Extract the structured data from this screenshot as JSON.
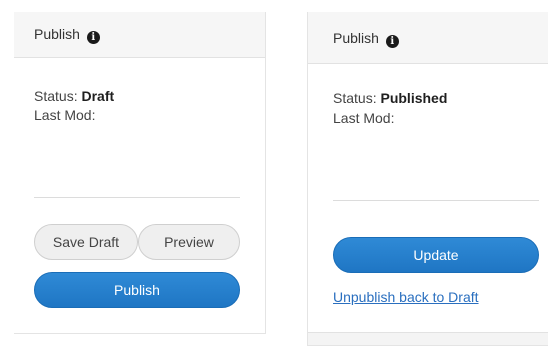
{
  "left_panel": {
    "title": "Publish",
    "info_icon": "i",
    "status_label": "Status:",
    "status_value": "Draft",
    "last_mod_label": "Last Mod:",
    "save_draft_label": "Save Draft",
    "preview_label": "Preview",
    "publish_label": "Publish"
  },
  "right_panel": {
    "title": "Publish",
    "info_icon": "i",
    "status_label": "Status:",
    "status_value": "Published",
    "last_mod_label": "Last Mod:",
    "update_label": "Update",
    "unpublish_label": "Unpublish back to Draft"
  },
  "colors": {
    "primary_button": "#1f76c4",
    "link": "#2a6fbf",
    "header_bg": "#f6f6f6"
  },
  "icons": {
    "info": "info-circle-icon"
  }
}
